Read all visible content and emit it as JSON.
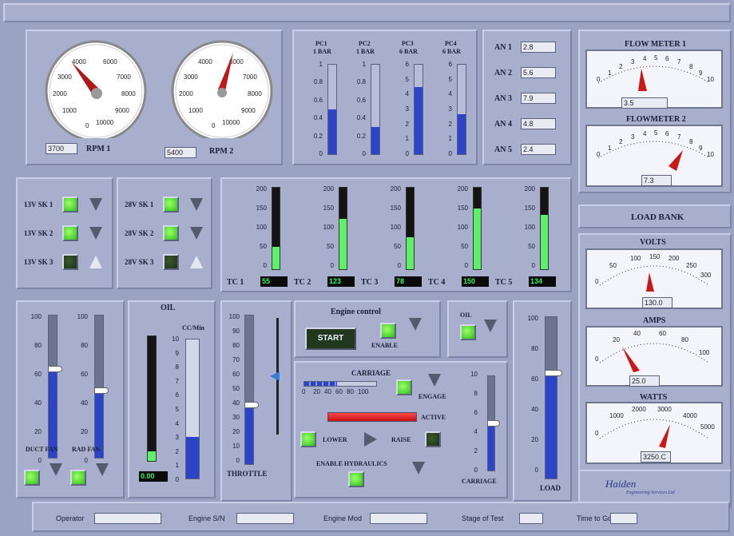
{
  "gauges": {
    "rpm1": {
      "label": "RPM 1",
      "value": "3700",
      "ticks": [
        "0",
        "1000",
        "2000",
        "3000",
        "4000",
        "6000",
        "7000",
        "8000",
        "9000",
        "10000"
      ]
    },
    "rpm2": {
      "label": "RPM 2",
      "value": "5400",
      "ticks": [
        "0",
        "1000",
        "2000",
        "3000",
        "4000",
        "6000",
        "7000",
        "8000",
        "9000",
        "10000"
      ]
    }
  },
  "pc": [
    {
      "title": "PC1",
      "sub": "1 BAR",
      "ticks": [
        "1",
        "0.8",
        "0.6",
        "0.4",
        "0.2",
        "0"
      ],
      "fill": 0.5
    },
    {
      "title": "PC2",
      "sub": "1 BAR",
      "ticks": [
        "1",
        "0.8",
        "0.6",
        "0.4",
        "0.2",
        "0"
      ],
      "fill": 0.3
    },
    {
      "title": "PC3",
      "sub": "6 BAR",
      "ticks": [
        "6",
        "5",
        "4",
        "3",
        "2",
        "1",
        "0"
      ],
      "fill": 0.75
    },
    {
      "title": "PC4",
      "sub": "6 BAR",
      "ticks": [
        "6",
        "5",
        "4",
        "3",
        "2",
        "1",
        "0"
      ],
      "fill": 0.45
    }
  ],
  "an": [
    {
      "label": "AN 1",
      "value": "2.8"
    },
    {
      "label": "AN 2",
      "value": "5.6"
    },
    {
      "label": "AN 3",
      "value": "7.9"
    },
    {
      "label": "AN 4",
      "value": "4.8"
    },
    {
      "label": "AN 5",
      "value": "2.4"
    }
  ],
  "flow": {
    "m1": {
      "title": "FLOW METER 1",
      "value": "3.5",
      "scale": [
        "0",
        "1",
        "2",
        "3",
        "4",
        "5",
        "6",
        "7",
        "8",
        "9",
        "10"
      ]
    },
    "m2": {
      "title": "FLOWMETER 2",
      "value": "7.3",
      "scale": [
        "0",
        "1",
        "2",
        "3",
        "4",
        "5",
        "6",
        "7",
        "8",
        "9",
        "10"
      ]
    }
  },
  "sk13": [
    {
      "label": "13V SK 1",
      "on": true
    },
    {
      "label": "13V SK 2",
      "on": true
    },
    {
      "label": "13V SK 3",
      "on": false
    }
  ],
  "sk28": [
    {
      "label": "28V SK 1",
      "on": true
    },
    {
      "label": "28V SK 2",
      "on": true
    },
    {
      "label": "28V SK 3",
      "on": false
    }
  ],
  "tc": {
    "ticks": [
      "200",
      "150",
      "100",
      "50",
      "0"
    ],
    "items": [
      {
        "label": "TC 1",
        "value": "55",
        "fill": 0.275
      },
      {
        "label": "TC 2",
        "value": "123",
        "fill": 0.615
      },
      {
        "label": "TC 3",
        "value": "78",
        "fill": 0.39
      },
      {
        "label": "TC 4",
        "value": "150",
        "fill": 0.75
      },
      {
        "label": "TC 5",
        "value": "134",
        "fill": 0.67
      }
    ]
  },
  "loadbank": {
    "title": "LOAD BANK",
    "volts": {
      "title": "VOLTS",
      "value": "130.0",
      "scale": [
        "0",
        "50",
        "100",
        "150",
        "200",
        "250",
        "300"
      ]
    },
    "amps": {
      "title": "AMPS",
      "value": "25.0",
      "scale": [
        "0",
        "20",
        "40",
        "60",
        "80",
        "100"
      ]
    },
    "watts": {
      "title": "WATTS",
      "value": "3250.C",
      "scale": [
        "0",
        "1000",
        "2000",
        "3000",
        "4000",
        "5000"
      ]
    }
  },
  "fans": {
    "ticks": [
      "100",
      "80",
      "60",
      "40",
      "20",
      "0"
    ],
    "duct": {
      "label": "DUCT FAN",
      "fill": 0.62
    },
    "rad": {
      "label": "RAD FAN",
      "fill": 0.47
    }
  },
  "oil": {
    "title": "OIL",
    "unit": "CC/Min",
    "ticks": [
      "10",
      "9",
      "8",
      "7",
      "6",
      "5",
      "4",
      "3",
      "2",
      "1",
      "0"
    ],
    "digital": "0.00",
    "fill": 0.3
  },
  "throttle": {
    "label": "THROTTLE",
    "ticks": [
      "100",
      "90",
      "80",
      "70",
      "60",
      "50",
      "40",
      "30",
      "20",
      "10",
      "0"
    ],
    "fill": 0.4,
    "setpoint": 0.5
  },
  "engine": {
    "title": "Engine control",
    "start": "START",
    "enable": "ENABLE"
  },
  "oil2": {
    "label": "OIL"
  },
  "carriage": {
    "title": "CARRIAGE",
    "scale": [
      "0",
      "20",
      "40",
      "60",
      "80",
      "100"
    ],
    "engage": "ENGAGE",
    "active": "ACTIVE",
    "lower": "LOWER",
    "raise": "RAISE",
    "hydraulics": "ENABLE HYDRAULICS",
    "vlabel": "CARRIAGE",
    "vticks": [
      "10",
      "8",
      "6",
      "4",
      "2",
      "0"
    ],
    "vfill": 0.5
  },
  "load": {
    "label": "LOAD",
    "ticks": [
      "100",
      "80",
      "60",
      "40",
      "20",
      "0"
    ],
    "fill": 0.65
  },
  "logo": {
    "name": "Haiden",
    "sub": "Engineering Services Ltd"
  },
  "footer": [
    {
      "label": "Operator"
    },
    {
      "label": "Engine S/N"
    },
    {
      "label": "Engine Mod"
    },
    {
      "label": "Stage of Test"
    },
    {
      "label": "Time to Go"
    }
  ],
  "colors": {
    "bg": "#9aa3c2",
    "panel": "#a7afcd",
    "led_on": "#3fd42a",
    "bar": "#2c45c8",
    "needle": "#cc2020",
    "tc": "#5ff06a"
  }
}
